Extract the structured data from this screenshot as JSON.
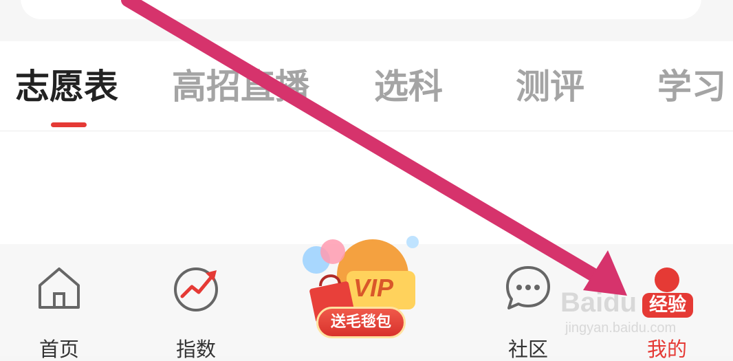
{
  "tabs": [
    {
      "label": "志愿表",
      "active": true
    },
    {
      "label": "高招直播",
      "active": false
    },
    {
      "label": "选科",
      "active": false
    },
    {
      "label": "测评",
      "active": false
    },
    {
      "label": "学习",
      "active": false
    }
  ],
  "bottom_nav": {
    "home": {
      "label": "首页",
      "icon": "home-icon"
    },
    "index": {
      "label": "指数",
      "icon": "trend-chart-icon"
    },
    "vip": {
      "text": "VIP",
      "promo": "送毛毯包",
      "icon": "gift-bag-icon"
    },
    "community": {
      "label": "社区",
      "icon": "chat-bubble-icon"
    },
    "mine": {
      "label": "我的",
      "icon": "user-avatar-icon"
    }
  },
  "watermark": {
    "brand": "Baidu",
    "badge": "经验",
    "url": "jingyan.baidu.com"
  },
  "colors": {
    "accent": "#e53a35",
    "annotation_arrow": "#d6336c"
  }
}
